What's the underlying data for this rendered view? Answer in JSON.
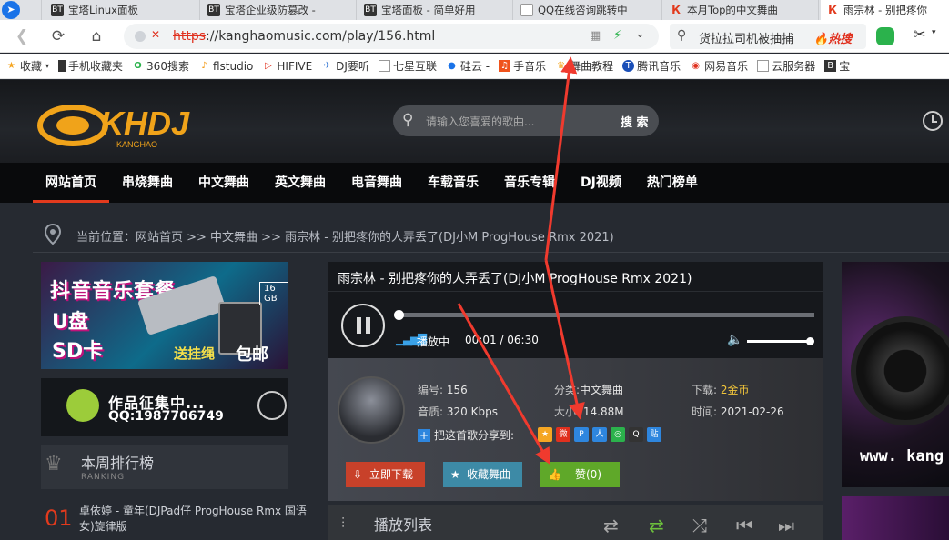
{
  "browser": {
    "tabs": [
      {
        "label": "宝塔Linux面板",
        "icon": "BT"
      },
      {
        "label": "宝塔企业级防篡改 -",
        "icon": "BT"
      },
      {
        "label": "宝塔面板 - 简单好用",
        "icon": "BT"
      },
      {
        "label": "QQ在线咨询跳转中",
        "icon": "doc"
      },
      {
        "label": "本月Top的中文舞曲",
        "icon": "K"
      },
      {
        "label": "雨宗林 - 别把疼你",
        "icon": "K"
      }
    ],
    "url_protocol": "https",
    "url_rest": "://kanghaomusic.com/play/156.html",
    "search_text": "货拉拉司机被抽捕",
    "search_hot": "热搜",
    "bookmarks": [
      "收藏",
      "手机收藏夹",
      "360搜索",
      "flstudio",
      "HIFIVE",
      "DJ要听",
      "七星互联",
      "硅云 -",
      "手音乐",
      "舞曲教程",
      "腾讯音乐",
      "网易音乐",
      "云服务器",
      "宝"
    ]
  },
  "site": {
    "logo_text": "KHDJ",
    "logo_sub": "KANGHAO",
    "search_placeholder": "请输入您喜爱的歌曲...",
    "search_button": "搜 索",
    "nav": [
      "网站首页",
      "串烧舞曲",
      "中文舞曲",
      "英文舞曲",
      "电音舞曲",
      "车载音乐",
      "音乐专辑",
      "DJ视频",
      "热门榜单"
    ],
    "breadcrumb": "当前位置：网站首页 >> 中文舞曲 >> 雨宗林 - 别把疼你的人弄丢了(DJ小M ProgHouse Rmx 2021)"
  },
  "sidebar": {
    "banner1_lines": [
      "抖音音乐套餐",
      "U盘",
      "SD卡",
      "送挂绳",
      "包邮"
    ],
    "banner1_badge": "16 GB",
    "banner2_text": "作品征集中...",
    "banner2_qq": "QQ:1987706749",
    "rank_title": "本周排行榜",
    "rank_sub": "RANKING",
    "rank_items": [
      {
        "num": "01",
        "title": "卓依婷 - 童年(DJPad仔 ProgHouse Rmx 国语女)旋律版"
      }
    ]
  },
  "player": {
    "title": "雨宗林 - 别把疼你的人弄丢了(DJ小M ProgHouse Rmx 2021)",
    "status": "播放中",
    "time": "00:01 / 06:30",
    "progress_fraction": 0.003,
    "volume_fraction": 1.0
  },
  "info": {
    "id_label": "编号:",
    "id": "156",
    "category_label": "分类:",
    "category": "中文舞曲",
    "download_label": "下载:",
    "download": "2金币",
    "quality_label": "音质:",
    "quality": "320 Kbps",
    "size_label": "大小:",
    "size": "14.88M",
    "date_label": "时间:",
    "date": "2021-02-26",
    "share_label": "把这首歌分享到:",
    "download_button": "立即下载",
    "favorite_button": "收藏舞曲",
    "like_button": "赞(0)"
  },
  "playlist": {
    "title": "播放列表"
  },
  "right_panel": {
    "text": "www. kang"
  },
  "colors": {
    "accent": "#e23a1d",
    "download_btn": "#c8412a",
    "favorite_btn": "#3d8aa6",
    "like_btn": "#5fa829",
    "gold": "#f0c43a"
  }
}
